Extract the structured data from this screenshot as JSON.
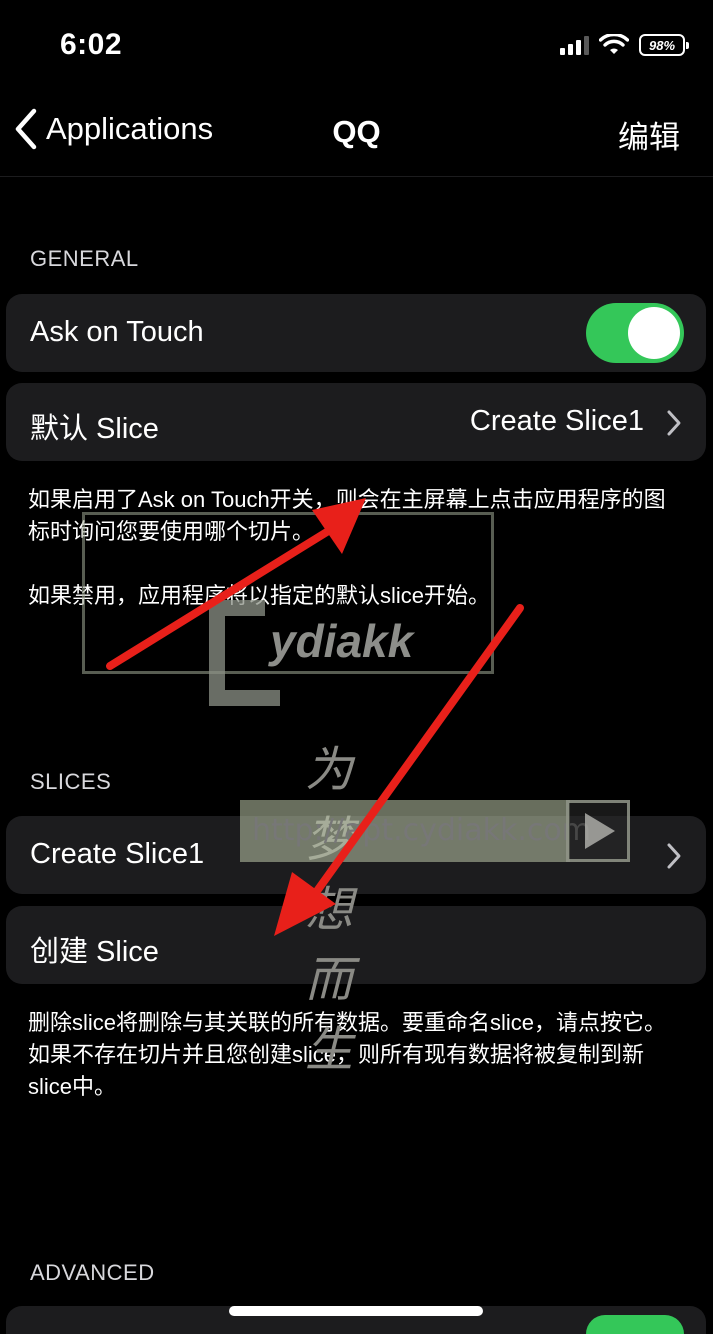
{
  "status_bar": {
    "time": "6:02",
    "battery": "98%"
  },
  "nav": {
    "back_label": "Applications",
    "title": "QQ",
    "edit_label": "编辑"
  },
  "general": {
    "header": "GENERAL",
    "ask_on_touch_label": "Ask on Touch",
    "ask_on_touch_on": true,
    "default_slice_label": "默认 Slice",
    "default_slice_value": "Create Slice1",
    "footer_line1": "如果启用了Ask on Touch开关，则会在主屏幕上点击应用程序的图标时询问您要使用哪个切片。",
    "footer_line2": "如果禁用，应用程序将以指定的默认slice开始。"
  },
  "slices": {
    "header": "SLICES",
    "items": [
      {
        "label": "Create Slice1"
      },
      {
        "label": "创建 Slice"
      }
    ],
    "footer": "删除slice将删除与其关联的所有数据。要重命名slice，请点按它。如果不存在切片并且您创建slice，则所有现有数据将被复制到新slice中。"
  },
  "advanced": {
    "header": "ADVANCED"
  },
  "watermark": {
    "brand": "ydiakk",
    "url": "http://apt.cydiakk.com",
    "slogan": "为梦想而生"
  },
  "colors": {
    "toggle_on": "#34c759",
    "cell_bg": "#1c1c1e",
    "arrow": "#e8201a"
  }
}
